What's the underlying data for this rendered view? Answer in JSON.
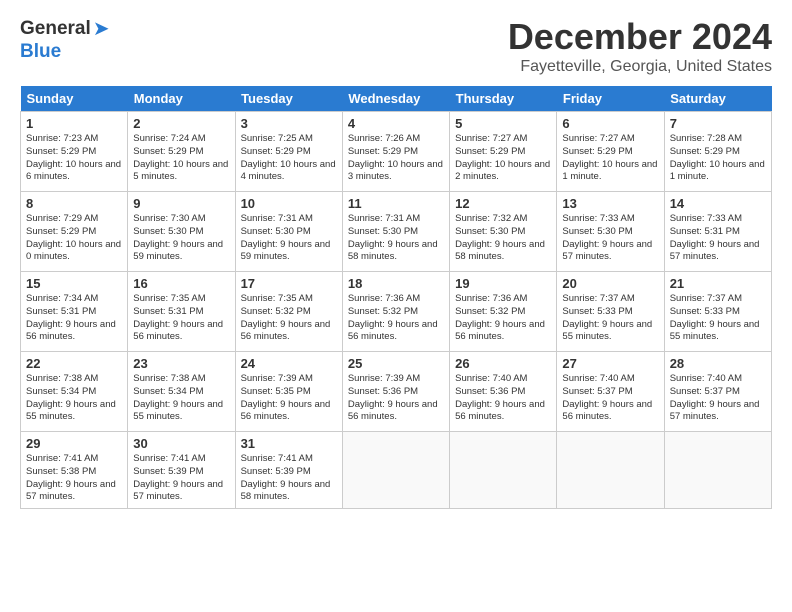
{
  "logo": {
    "general": "General",
    "blue": "Blue"
  },
  "title": "December 2024",
  "location": "Fayetteville, Georgia, United States",
  "days_header": [
    "Sunday",
    "Monday",
    "Tuesday",
    "Wednesday",
    "Thursday",
    "Friday",
    "Saturday"
  ],
  "weeks": [
    [
      {
        "day": "1",
        "sunrise": "Sunrise: 7:23 AM",
        "sunset": "Sunset: 5:29 PM",
        "daylight": "Daylight: 10 hours and 6 minutes."
      },
      {
        "day": "2",
        "sunrise": "Sunrise: 7:24 AM",
        "sunset": "Sunset: 5:29 PM",
        "daylight": "Daylight: 10 hours and 5 minutes."
      },
      {
        "day": "3",
        "sunrise": "Sunrise: 7:25 AM",
        "sunset": "Sunset: 5:29 PM",
        "daylight": "Daylight: 10 hours and 4 minutes."
      },
      {
        "day": "4",
        "sunrise": "Sunrise: 7:26 AM",
        "sunset": "Sunset: 5:29 PM",
        "daylight": "Daylight: 10 hours and 3 minutes."
      },
      {
        "day": "5",
        "sunrise": "Sunrise: 7:27 AM",
        "sunset": "Sunset: 5:29 PM",
        "daylight": "Daylight: 10 hours and 2 minutes."
      },
      {
        "day": "6",
        "sunrise": "Sunrise: 7:27 AM",
        "sunset": "Sunset: 5:29 PM",
        "daylight": "Daylight: 10 hours and 1 minute."
      },
      {
        "day": "7",
        "sunrise": "Sunrise: 7:28 AM",
        "sunset": "Sunset: 5:29 PM",
        "daylight": "Daylight: 10 hours and 1 minute."
      }
    ],
    [
      {
        "day": "8",
        "sunrise": "Sunrise: 7:29 AM",
        "sunset": "Sunset: 5:29 PM",
        "daylight": "Daylight: 10 hours and 0 minutes."
      },
      {
        "day": "9",
        "sunrise": "Sunrise: 7:30 AM",
        "sunset": "Sunset: 5:30 PM",
        "daylight": "Daylight: 9 hours and 59 minutes."
      },
      {
        "day": "10",
        "sunrise": "Sunrise: 7:31 AM",
        "sunset": "Sunset: 5:30 PM",
        "daylight": "Daylight: 9 hours and 59 minutes."
      },
      {
        "day": "11",
        "sunrise": "Sunrise: 7:31 AM",
        "sunset": "Sunset: 5:30 PM",
        "daylight": "Daylight: 9 hours and 58 minutes."
      },
      {
        "day": "12",
        "sunrise": "Sunrise: 7:32 AM",
        "sunset": "Sunset: 5:30 PM",
        "daylight": "Daylight: 9 hours and 58 minutes."
      },
      {
        "day": "13",
        "sunrise": "Sunrise: 7:33 AM",
        "sunset": "Sunset: 5:30 PM",
        "daylight": "Daylight: 9 hours and 57 minutes."
      },
      {
        "day": "14",
        "sunrise": "Sunrise: 7:33 AM",
        "sunset": "Sunset: 5:31 PM",
        "daylight": "Daylight: 9 hours and 57 minutes."
      }
    ],
    [
      {
        "day": "15",
        "sunrise": "Sunrise: 7:34 AM",
        "sunset": "Sunset: 5:31 PM",
        "daylight": "Daylight: 9 hours and 56 minutes."
      },
      {
        "day": "16",
        "sunrise": "Sunrise: 7:35 AM",
        "sunset": "Sunset: 5:31 PM",
        "daylight": "Daylight: 9 hours and 56 minutes."
      },
      {
        "day": "17",
        "sunrise": "Sunrise: 7:35 AM",
        "sunset": "Sunset: 5:32 PM",
        "daylight": "Daylight: 9 hours and 56 minutes."
      },
      {
        "day": "18",
        "sunrise": "Sunrise: 7:36 AM",
        "sunset": "Sunset: 5:32 PM",
        "daylight": "Daylight: 9 hours and 56 minutes."
      },
      {
        "day": "19",
        "sunrise": "Sunrise: 7:36 AM",
        "sunset": "Sunset: 5:32 PM",
        "daylight": "Daylight: 9 hours and 56 minutes."
      },
      {
        "day": "20",
        "sunrise": "Sunrise: 7:37 AM",
        "sunset": "Sunset: 5:33 PM",
        "daylight": "Daylight: 9 hours and 55 minutes."
      },
      {
        "day": "21",
        "sunrise": "Sunrise: 7:37 AM",
        "sunset": "Sunset: 5:33 PM",
        "daylight": "Daylight: 9 hours and 55 minutes."
      }
    ],
    [
      {
        "day": "22",
        "sunrise": "Sunrise: 7:38 AM",
        "sunset": "Sunset: 5:34 PM",
        "daylight": "Daylight: 9 hours and 55 minutes."
      },
      {
        "day": "23",
        "sunrise": "Sunrise: 7:38 AM",
        "sunset": "Sunset: 5:34 PM",
        "daylight": "Daylight: 9 hours and 55 minutes."
      },
      {
        "day": "24",
        "sunrise": "Sunrise: 7:39 AM",
        "sunset": "Sunset: 5:35 PM",
        "daylight": "Daylight: 9 hours and 56 minutes."
      },
      {
        "day": "25",
        "sunrise": "Sunrise: 7:39 AM",
        "sunset": "Sunset: 5:36 PM",
        "daylight": "Daylight: 9 hours and 56 minutes."
      },
      {
        "day": "26",
        "sunrise": "Sunrise: 7:40 AM",
        "sunset": "Sunset: 5:36 PM",
        "daylight": "Daylight: 9 hours and 56 minutes."
      },
      {
        "day": "27",
        "sunrise": "Sunrise: 7:40 AM",
        "sunset": "Sunset: 5:37 PM",
        "daylight": "Daylight: 9 hours and 56 minutes."
      },
      {
        "day": "28",
        "sunrise": "Sunrise: 7:40 AM",
        "sunset": "Sunset: 5:37 PM",
        "daylight": "Daylight: 9 hours and 57 minutes."
      }
    ],
    [
      {
        "day": "29",
        "sunrise": "Sunrise: 7:41 AM",
        "sunset": "Sunset: 5:38 PM",
        "daylight": "Daylight: 9 hours and 57 minutes."
      },
      {
        "day": "30",
        "sunrise": "Sunrise: 7:41 AM",
        "sunset": "Sunset: 5:39 PM",
        "daylight": "Daylight: 9 hours and 57 minutes."
      },
      {
        "day": "31",
        "sunrise": "Sunrise: 7:41 AM",
        "sunset": "Sunset: 5:39 PM",
        "daylight": "Daylight: 9 hours and 58 minutes."
      },
      null,
      null,
      null,
      null
    ]
  ]
}
